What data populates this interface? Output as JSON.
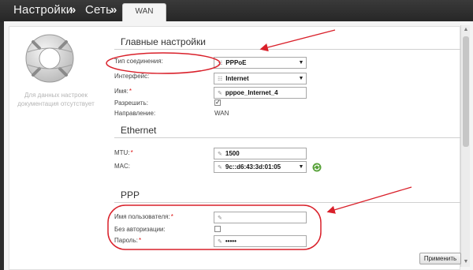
{
  "breadcrumb": {
    "item1": "Настройки",
    "item2": "Сеть",
    "separator": "»"
  },
  "tab": {
    "label": "WAN"
  },
  "help_text": "Для данных настроек документация отсутствует",
  "sections": {
    "main": "Главные настройки",
    "ethernet": "Ethernet",
    "ppp": "PPP"
  },
  "main_settings": {
    "connection_type_label": "Тип соединения:",
    "connection_type_value": "PPPoE",
    "interface_label": "Интерфейс:",
    "interface_value": "Internet",
    "name_label": "Имя:",
    "name_value": "pppoe_Internet_4",
    "enable_label": "Разрешить:",
    "enable_checked": true,
    "direction_label": "Направление:",
    "direction_value": "WAN"
  },
  "ethernet": {
    "mtu_label": "MTU:",
    "mtu_value": "1500",
    "mac_label": "MAC:",
    "mac_value": "9c::d6:43:3d:01:05"
  },
  "ppp": {
    "username_label": "Имя пользователя:",
    "username_value": "",
    "no_auth_label": "Без авторизации:",
    "no_auth_checked": false,
    "password_label": "Пароль:",
    "password_value": "•••••"
  },
  "apply_label": "Применить",
  "colors": {
    "annotation": "#d9202a",
    "background_dark": "#2b2b2b",
    "panel": "#f4f4f4"
  }
}
